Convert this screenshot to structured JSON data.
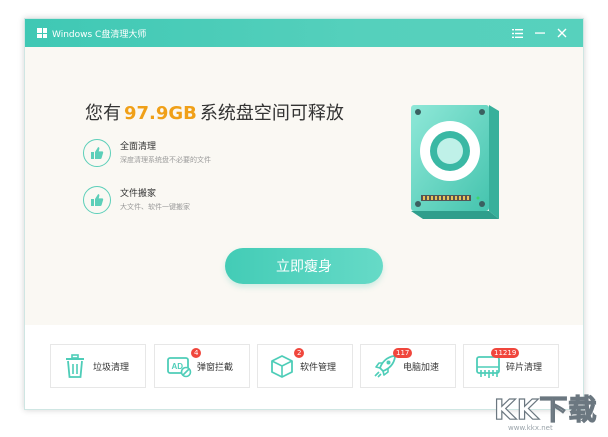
{
  "window": {
    "title": "Windows C盘清理大师"
  },
  "main": {
    "headline_prefix": "您有",
    "headline_value": "97.9GB",
    "headline_suffix": "系统盘空间可释放",
    "features": [
      {
        "title": "全面清理",
        "desc": "深度清理系统盘不必要的文件"
      },
      {
        "title": "文件搬家",
        "desc": "大文件、软件一键搬家"
      }
    ],
    "cta_label": "立即瘦身"
  },
  "tools": [
    {
      "label": "垃圾清理",
      "icon": "trash-icon",
      "badge": ""
    },
    {
      "label": "弹窗拦截",
      "icon": "ad-block-icon",
      "badge": "4"
    },
    {
      "label": "软件管理",
      "icon": "box-icon",
      "badge": "2"
    },
    {
      "label": "电脑加速",
      "icon": "rocket-icon",
      "badge": "117"
    },
    {
      "label": "碎片清理",
      "icon": "fragment-icon",
      "badge": "11219"
    }
  ],
  "watermark": {
    "main": "KK下载",
    "sub": "www.kkx.net"
  },
  "colors": {
    "accent": "#4ecdb8",
    "highlight": "#f0a018",
    "badge": "#f0463c"
  }
}
